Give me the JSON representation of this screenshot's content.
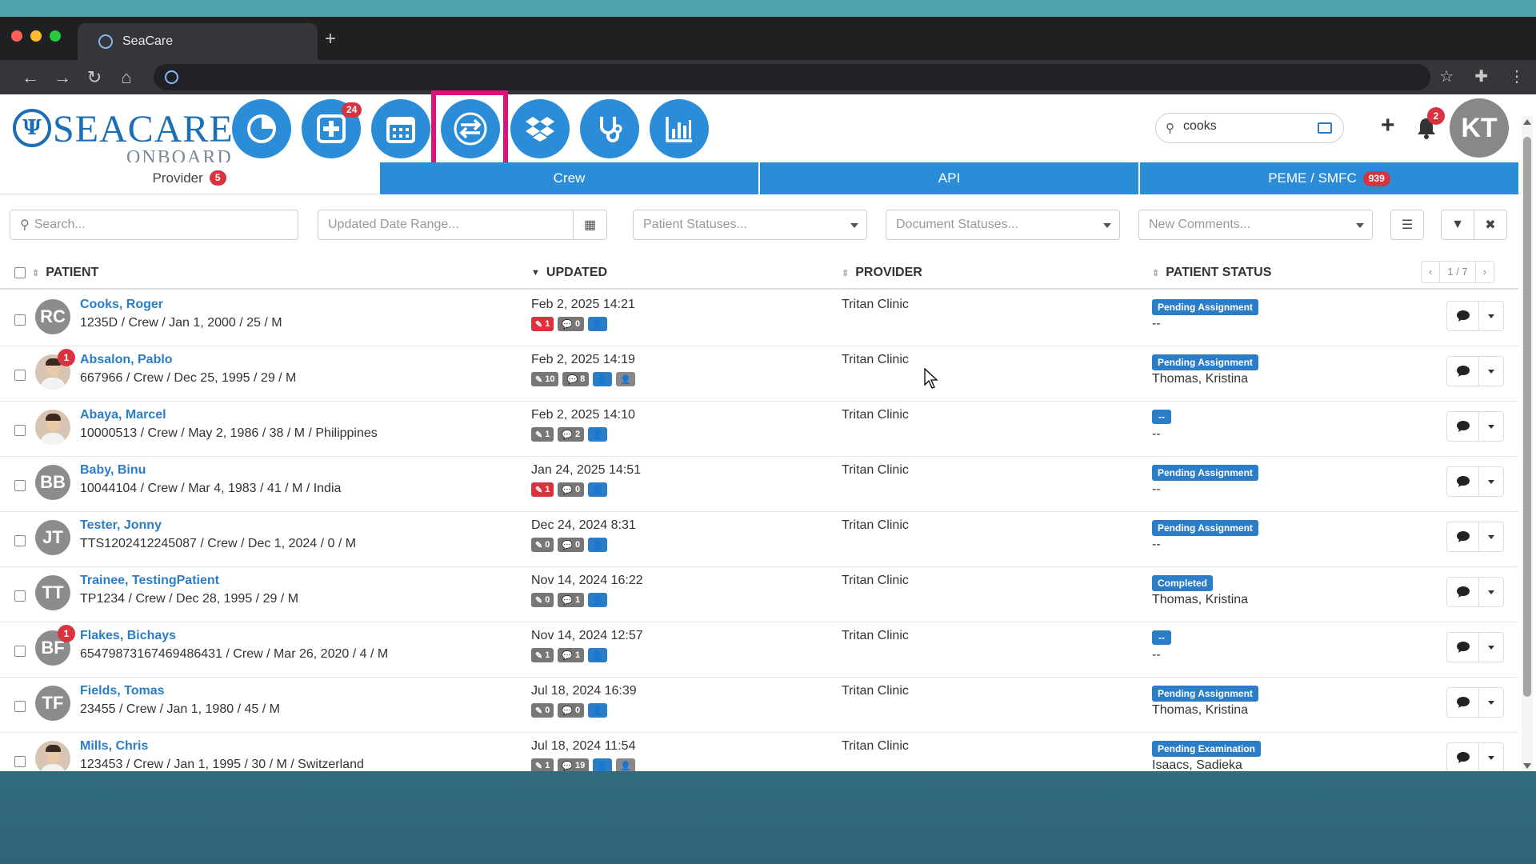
{
  "browser": {
    "tab_title": "SeaCare",
    "new_tab": "+"
  },
  "header": {
    "logo_main": "SEACARE",
    "logo_sub": "ONBOARD",
    "add_badge": "24",
    "search_value": "cooks",
    "notifications_badge": "2",
    "avatar_initials": "KT"
  },
  "tabs": [
    {
      "label": "Provider",
      "badge": "5"
    },
    {
      "label": "Crew"
    },
    {
      "label": "API"
    },
    {
      "label": "PEME / SMFC",
      "badge": "939"
    }
  ],
  "filters": {
    "search_placeholder": "Search...",
    "date_placeholder": "Updated Date Range...",
    "patient_statuses": "Patient Statuses...",
    "document_statuses": "Document Statuses...",
    "new_comments": "New Comments..."
  },
  "table": {
    "headers": {
      "patient": "PATIENT",
      "updated": "UPDATED",
      "provider": "PROVIDER",
      "status": "PATIENT STATUS"
    },
    "pager": {
      "prev": "‹",
      "page": "1 / 7",
      "next": "›"
    },
    "rows": [
      {
        "initials": "RC",
        "name": "Cooks, Roger",
        "info": "1235D / Crew / Jan 1, 2000 / 25 / M",
        "updated": "Feb 2, 2025 14:21",
        "c1": "1",
        "c2": "0",
        "provider": "Tritan Clinic",
        "status": "Pending Assignment",
        "assignee": "--"
      },
      {
        "initials": "",
        "name": "Absalon, Pablo",
        "info": "667966 / Crew / Dec 25, 1995 / 29 / M",
        "updated": "Feb 2, 2025 14:19",
        "c1": "10",
        "c2": "8",
        "provider": "Tritan Clinic",
        "status": "Pending Assignment",
        "assignee": "Thomas, Kristina",
        "alert": "1"
      },
      {
        "initials": "",
        "name": "Abaya, Marcel",
        "info": "10000513 / Crew / May 2, 1986 / 38 / M / Philippines",
        "updated": "Feb 2, 2025 14:10",
        "c1": "1",
        "c2": "2",
        "provider": "Tritan Clinic",
        "status": "--",
        "assignee": "--"
      },
      {
        "initials": "BB",
        "name": "Baby, Binu",
        "info": "10044104 / Crew / Mar 4, 1983 / 41 / M / India",
        "updated": "Jan 24, 2025 14:51",
        "c1": "1",
        "c2": "0",
        "provider": "Tritan Clinic",
        "status": "Pending Assignment",
        "assignee": "--"
      },
      {
        "initials": "JT",
        "name": "Tester, Jonny",
        "info": "TTS1202412245087 / Crew / Dec 1, 2024 / 0 / M",
        "updated": "Dec 24, 2024 8:31",
        "c1": "0",
        "c2": "0",
        "provider": "Tritan Clinic",
        "status": "Pending Assignment",
        "assignee": "--"
      },
      {
        "initials": "TT",
        "name": "Trainee, TestingPatient",
        "info": "TP1234 / Crew / Dec 28, 1995 / 29 / M",
        "updated": "Nov 14, 2024 16:22",
        "c1": "0",
        "c2": "1",
        "provider": "Tritan Clinic",
        "status": "Completed",
        "assignee": "Thomas, Kristina"
      },
      {
        "initials": "BF",
        "name": "Flakes, Bichays",
        "info": "6547987316746948643‌1 / Crew / Mar 26, 2020 / 4 / M",
        "updated": "Nov 14, 2024 12:57",
        "c1": "1",
        "c2": "1",
        "provider": "Tritan Clinic",
        "status": "--",
        "assignee": "--",
        "alert": "1"
      },
      {
        "initials": "TF",
        "name": "Fields, Tomas",
        "info": "23455 / Crew / Jan 1, 1980 / 45 / M",
        "updated": "Jul 18, 2024 16:39",
        "c1": "0",
        "c2": "0",
        "provider": "Tritan Clinic",
        "status": "Pending Assignment",
        "assignee": "Thomas, Kristina"
      },
      {
        "initials": "",
        "name": "Mills, Chris",
        "info": "123453 / Crew / Jan 1, 1995 / 30 / M / Switzerland",
        "updated": "Jul 18, 2024 11:54",
        "c1": "1",
        "c2": "19",
        "provider": "Tritan Clinic",
        "status": "Pending Examination",
        "assignee": "Isaacs, Sadieka"
      }
    ]
  },
  "colors": {
    "brand_blue": "#2b8dd8",
    "link_blue": "#2b7dc7",
    "badge_red": "#d9333f",
    "highlight_pink": "#e0117a"
  }
}
